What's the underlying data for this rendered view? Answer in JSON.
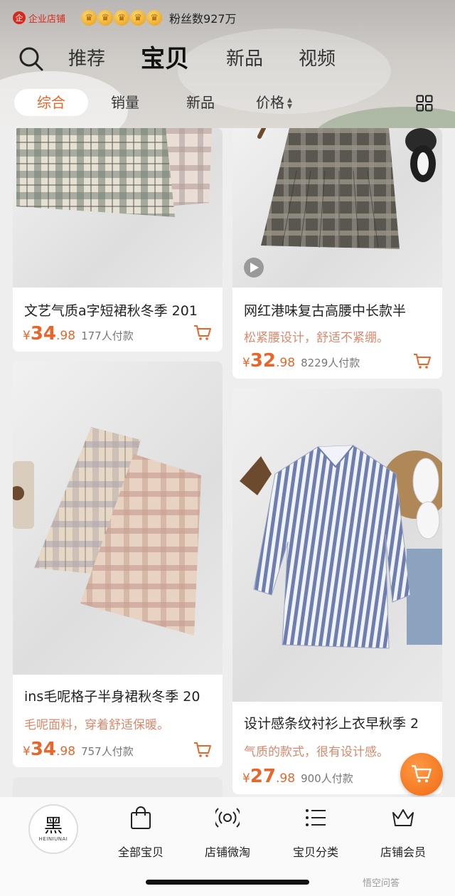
{
  "header": {
    "store_badge": "企业店铺",
    "fans": "粉丝数927万",
    "crowns": [
      "crown",
      "crown",
      "crown",
      "crown",
      "crown"
    ]
  },
  "nav": {
    "tabs": [
      {
        "label": "推荐"
      },
      {
        "label": "宝贝"
      },
      {
        "label": "新品"
      },
      {
        "label": "视频"
      }
    ],
    "active_tab": "宝贝"
  },
  "filter": {
    "items": [
      {
        "label": "综合"
      },
      {
        "label": "销量"
      },
      {
        "label": "新品"
      },
      {
        "label": "价格"
      }
    ],
    "active": "综合"
  },
  "products": [
    {
      "title": "文艺气质a字短裙秋冬季 201",
      "desc": "",
      "currency": "¥",
      "price_int": "34",
      "price_dec": ".98",
      "sold": "177人付款"
    },
    {
      "title": "网红港味复古高腰中长款半",
      "desc": "松紧腰设计，舒适不紧绷。",
      "currency": "¥",
      "price_int": "32",
      "price_dec": ".98",
      "sold": "8229人付款"
    },
    {
      "title": "ins毛呢格子半身裙秋冬季 20",
      "desc": "毛呢面料，穿着舒适保暖。",
      "currency": "¥",
      "price_int": "34",
      "price_dec": ".98",
      "sold": "757人付款"
    },
    {
      "title": "设计感条纹衬衫上衣早秋季 2",
      "desc": "气质的款式，很有设计感。",
      "currency": "¥",
      "price_int": "27",
      "price_dec": ".98",
      "sold": "900人付款"
    }
  ],
  "bottom_nav": {
    "logo_main": "黑",
    "logo_sub": "HEINIUNAI",
    "items": [
      {
        "label": "全部宝贝",
        "icon": "shopping-bag-icon"
      },
      {
        "label": "店铺微淘",
        "icon": "broadcast-icon"
      },
      {
        "label": "宝贝分类",
        "icon": "list-icon"
      },
      {
        "label": "店铺会员",
        "icon": "crown-icon"
      }
    ]
  },
  "watermark": "悟空问答",
  "colors": {
    "accent": "#e8662a",
    "desc": "#d9896b",
    "badge_red": "#d6281c",
    "fab": "#ef6a12"
  }
}
